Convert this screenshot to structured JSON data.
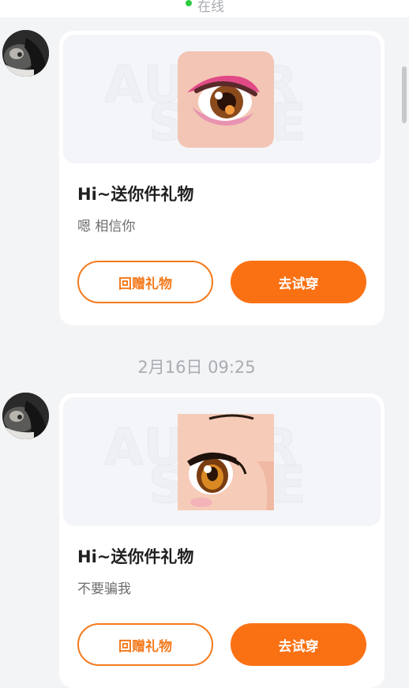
{
  "header": {
    "status_text": "在线"
  },
  "messages": [
    {
      "title": "Hi~送你件礼物",
      "message": "嗯 相信你",
      "watermark_line1": "AUTAR",
      "watermark_line2": "SORE",
      "buttons": {
        "return_gift": "回赠礼物",
        "try_on": "去试穿"
      }
    },
    {
      "title": "Hi~送你件礼物",
      "message": "不要骗我",
      "watermark_line1": "AUTAR",
      "watermark_line2": "SORE",
      "buttons": {
        "return_gift": "回赠礼物",
        "try_on": "去试穿"
      }
    }
  ],
  "timestamp": "2月16日 09:25",
  "colors": {
    "accent": "#fa7114",
    "accent_outline": "#f47a1c",
    "online": "#2ecc40",
    "muted_text": "#a9acb2"
  },
  "icons": [
    "user-avatar",
    "pink-eye-makeup-thumbnail",
    "anime-eye-thumbnail"
  ]
}
